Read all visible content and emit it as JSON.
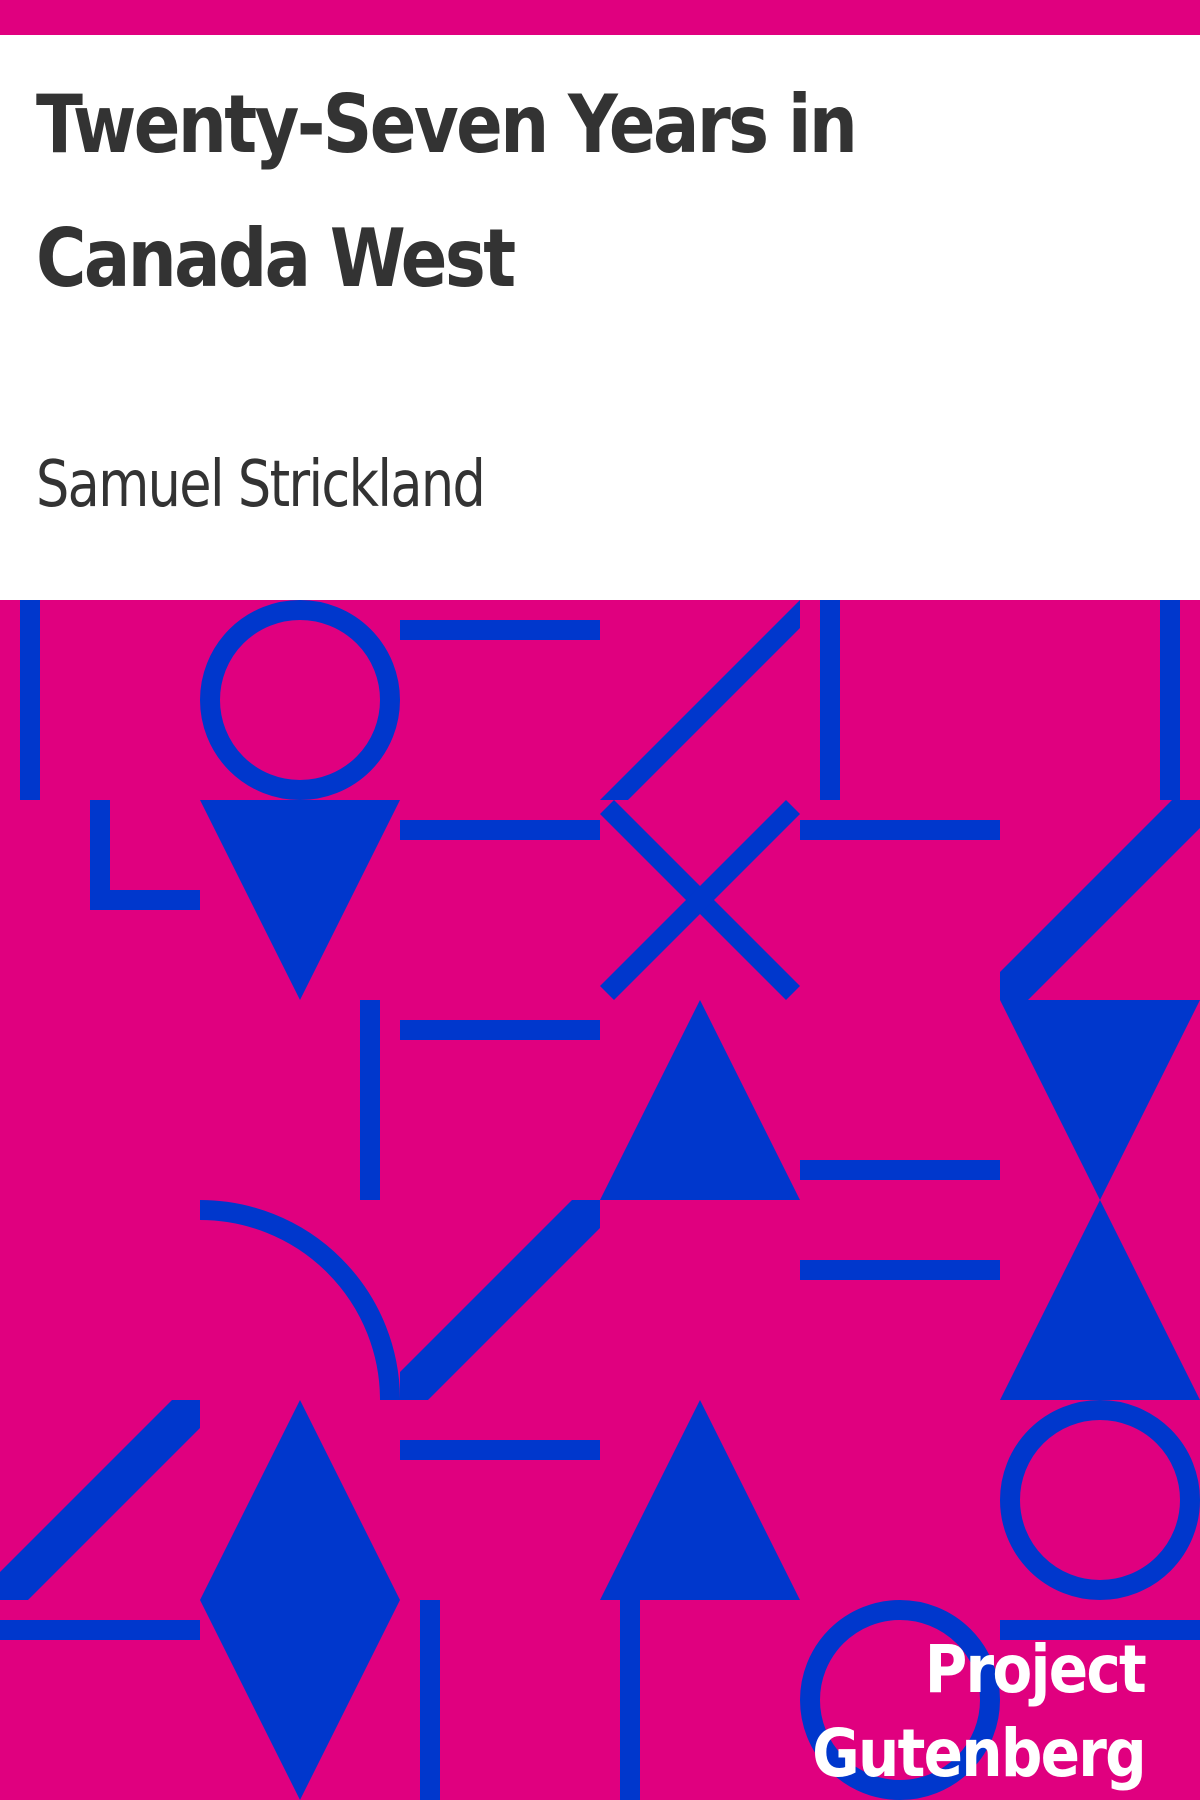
{
  "cover": {
    "title": "Twenty-Seven Years in Canada West",
    "author": "Samuel Strickland",
    "publisher": "Project Gutenberg"
  },
  "colors": {
    "background": "#e0007f",
    "shapes": "#0037cc",
    "title_text": "#333333",
    "publisher_text": "#ffffff"
  }
}
